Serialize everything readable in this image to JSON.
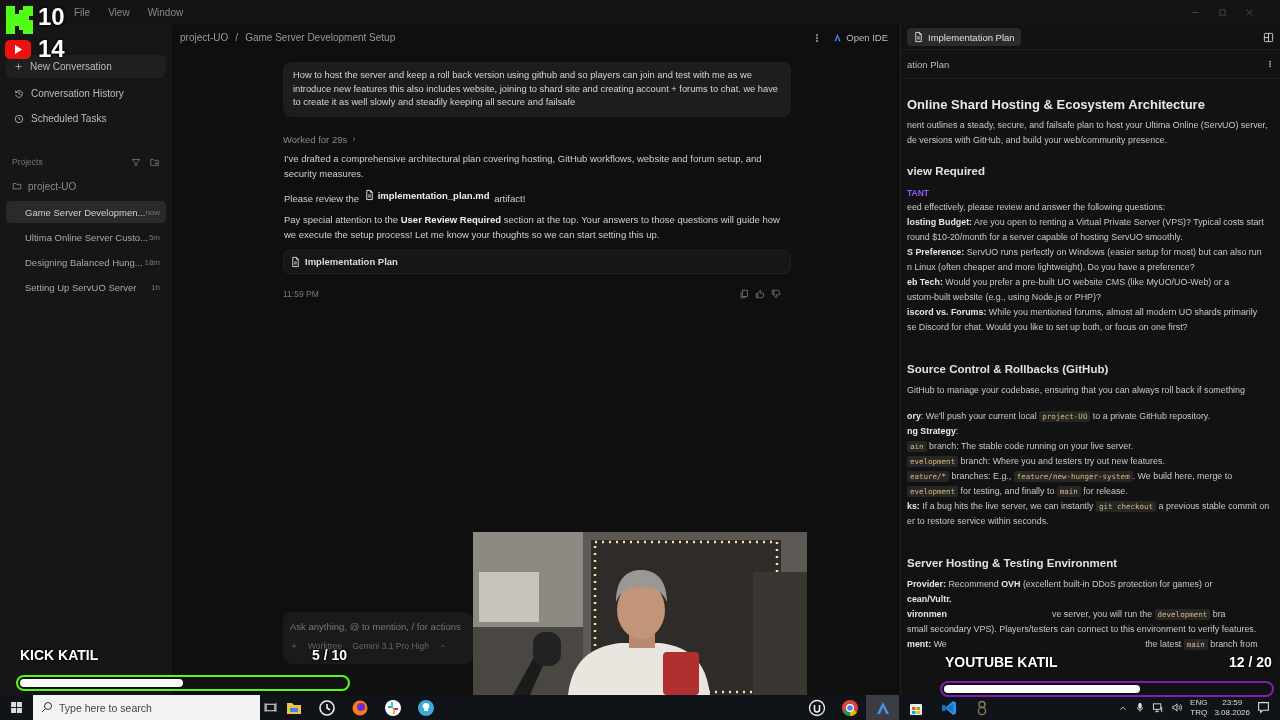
{
  "menu": [
    "File",
    "View",
    "Window"
  ],
  "sidebar": {
    "actions": [
      {
        "label": "New Conversation",
        "kind": "plus"
      },
      {
        "label": "Conversation History",
        "kind": "history"
      },
      {
        "label": "Scheduled Tasks",
        "kind": "clock"
      }
    ],
    "projects_label": "Projects",
    "project": "project-UO",
    "conversations": [
      {
        "title": "Game Server Developmen...",
        "time": "now",
        "selected": true
      },
      {
        "title": "Ultima Online Server Custo...",
        "time": "5m",
        "selected": false
      },
      {
        "title": "Designing Balanced Hung...",
        "time": "18m",
        "selected": false
      },
      {
        "title": "Setting Up ServUO Server",
        "time": "1h",
        "selected": false
      }
    ]
  },
  "breadcrumb": {
    "parent": "project-UO",
    "separator": "/",
    "title": "Game Server Development Setup"
  },
  "open_ide": "Open IDE",
  "chat": {
    "user_message": "How to host the server and keep a roll back version using github and so players can join and test with me as we introduce new features this also includes website, joining to shard site and creating account + forums to chat. we have to create it as well slowly and steadily keeping all secure and failsafe",
    "worked": "Worked for 29s",
    "summary": "I've drafted a comprehensive architectural plan covering hosting, GitHub workflows, website and forum setup, and security measures.",
    "review": {
      "before": "Please review the",
      "file": "implementation_plan.md",
      "after": "artifact!"
    },
    "attention": "Pay special attention to the **User Review Required** section at the top. Your answers to those questions will guide how we execute the setup process! Let me know your thoughts so we can start setting this up.",
    "artifact": "Implementation Plan",
    "time": "11:59 PM"
  },
  "input": {
    "placeholder": "Ask anything, @ to mention, / for actions",
    "worktree": "Worktree",
    "model": "Gemini 3.1 Pro High"
  },
  "panel": {
    "tab": {
      "label": "Implementation Plan",
      "selected": true
    },
    "title": "ation Plan",
    "lines": [
      {
        "kind": "h1",
        "segs": [
          {
            "kind": "plain",
            "text": "Online Shard Hosting & Ecosystem Architecture"
          }
        ]
      },
      {
        "kind": "p",
        "segs": [
          {
            "kind": "plain",
            "text": "nent outlines a steady, secure, and failsafe plan to host your Ultima Online (ServUO) server,"
          }
        ]
      },
      {
        "kind": "p",
        "segs": [
          {
            "kind": "plain",
            "text": "de versions with GitHub, and build your web/community presence."
          }
        ]
      },
      {
        "kind": "h2",
        "segs": [
          {
            "kind": "plain",
            "text": "view Required"
          }
        ]
      },
      {
        "kind": "alert",
        "segs": [
          {
            "kind": "plain",
            "text": "TANT"
          }
        ]
      },
      {
        "kind": "p",
        "segs": [
          {
            "kind": "plain",
            "text": "eed effectively, please review and answer the following questions:"
          }
        ]
      },
      {
        "kind": "p",
        "segs": [
          {
            "kind": "bold",
            "text": "losting Budget:"
          },
          {
            "kind": "plain",
            "text": " Are you open to renting a Virtual Private Server (VPS)? Typical costs start"
          }
        ]
      },
      {
        "kind": "p",
        "segs": [
          {
            "kind": "plain",
            "text": "round $10-20/month for a server capable of hosting ServUO smoothly."
          }
        ]
      },
      {
        "kind": "p",
        "segs": [
          {
            "kind": "bold",
            "text": "S Preference:"
          },
          {
            "kind": "plain",
            "text": " ServUO runs perfectly on Windows (easier setup for most) but can also run"
          }
        ]
      },
      {
        "kind": "p",
        "segs": [
          {
            "kind": "plain",
            "text": "n Linux (often cheaper and more lightweight). Do you have a preference?"
          }
        ]
      },
      {
        "kind": "p",
        "segs": [
          {
            "kind": "bold",
            "text": "eb Tech:"
          },
          {
            "kind": "plain",
            "text": " Would you prefer a pre-built UO website CMS (like MyUO/UO-Web) or a"
          }
        ]
      },
      {
        "kind": "p",
        "segs": [
          {
            "kind": "plain",
            "text": "ustom-built website (e.g., using Node.js or PHP)?"
          }
        ]
      },
      {
        "kind": "p",
        "segs": [
          {
            "kind": "bold",
            "text": "iscord vs. Forums:"
          },
          {
            "kind": "plain",
            "text": " While you mentioned forums, almost all modern UO shards primarily"
          }
        ]
      },
      {
        "kind": "p",
        "segs": [
          {
            "kind": "plain",
            "text": "se Discord for chat. Would you like to set up both, or focus on one first?"
          }
        ]
      },
      {
        "kind": "space"
      },
      {
        "kind": "h2",
        "segs": [
          {
            "kind": "plain",
            "text": "Source Control & Rollbacks (GitHub)"
          }
        ]
      },
      {
        "kind": "p",
        "segs": [
          {
            "kind": "plain",
            "text": "GitHub to manage your codebase, ensuring that you can always roll back if something"
          }
        ]
      },
      {
        "kind": "space"
      },
      {
        "kind": "p",
        "segs": [
          {
            "kind": "bold",
            "text": "ory"
          },
          {
            "kind": "plain",
            "text": ": We'll push your current local "
          },
          {
            "kind": "code",
            "text": "project-UO"
          },
          {
            "kind": "plain",
            "text": " to a private GitHub repository."
          }
        ]
      },
      {
        "kind": "p",
        "segs": [
          {
            "kind": "bold",
            "text": "ng Strategy"
          },
          {
            "kind": "plain",
            "text": ":"
          }
        ]
      },
      {
        "kind": "p",
        "segs": [
          {
            "kind": "code",
            "text": "ain"
          },
          {
            "kind": "plain",
            "text": " branch: The stable code running on your live server."
          }
        ]
      },
      {
        "kind": "p",
        "segs": [
          {
            "kind": "code",
            "text": "evelopment"
          },
          {
            "kind": "plain",
            "text": " branch: Where you and testers try out new features."
          }
        ]
      },
      {
        "kind": "p",
        "segs": [
          {
            "kind": "code",
            "text": "eature/*"
          },
          {
            "kind": "plain",
            "text": " branches: E.g., "
          },
          {
            "kind": "code",
            "text": "feature/new-hunger-system"
          },
          {
            "kind": "plain",
            "text": ". We build here, merge to"
          }
        ]
      },
      {
        "kind": "p",
        "segs": [
          {
            "kind": "code",
            "text": "evelopment"
          },
          {
            "kind": "plain",
            "text": " for testing, and finally to "
          },
          {
            "kind": "code",
            "text": "main"
          },
          {
            "kind": "plain",
            "text": " for release."
          }
        ]
      },
      {
        "kind": "p",
        "segs": [
          {
            "kind": "bold",
            "text": "ks:"
          },
          {
            "kind": "plain",
            "text": " If a bug hits the live server, we can instantly "
          },
          {
            "kind": "code",
            "text": "git checkout"
          },
          {
            "kind": "plain",
            "text": " a previous stable commit on"
          }
        ]
      },
      {
        "kind": "p",
        "segs": [
          {
            "kind": "plain",
            "text": "er to restore service within seconds."
          }
        ]
      },
      {
        "kind": "space"
      },
      {
        "kind": "h2",
        "segs": [
          {
            "kind": "plain",
            "text": "Server Hosting & Testing Environment"
          }
        ]
      },
      {
        "kind": "p",
        "segs": [
          {
            "kind": "bold",
            "text": "Provider:"
          },
          {
            "kind": "plain",
            "text": " Recommend "
          },
          {
            "kind": "bold",
            "text": "OVH"
          },
          {
            "kind": "plain",
            "text": " (excellent built-in DDoS protection for games) or"
          }
        ]
      },
      {
        "kind": "p",
        "segs": [
          {
            "kind": "bold",
            "text": "cean/Vultr."
          }
        ]
      },
      {
        "kind": "p",
        "segs": [
          {
            "kind": "bold",
            "text": "vironmen"
          },
          {
            "kind": "gap"
          },
          {
            "kind": "plain",
            "text": "ve server, you will run the "
          },
          {
            "kind": "code",
            "text": "development"
          },
          {
            "kind": "plain",
            "text": " bra"
          }
        ]
      },
      {
        "kind": "p",
        "segs": [
          {
            "kind": "plain",
            "text": "small secondary VPS). Players/testers can connect to this environment to verify features."
          }
        ]
      },
      {
        "kind": "p",
        "segs": [
          {
            "kind": "bold",
            "text": "ment:"
          },
          {
            "kind": "plain",
            "text": " We"
          },
          {
            "kind": "gap-wide"
          },
          {
            "kind": "plain",
            "text": " the latest "
          },
          {
            "kind": "code",
            "text": "main"
          },
          {
            "kind": "plain",
            "text": " branch from"
          }
        ]
      }
    ]
  },
  "overlays": {
    "kick_count": "10",
    "youtube_count": "14",
    "kick_goal": {
      "label": "KICK KATIL",
      "count": "5 / 10",
      "level": 0.5
    },
    "youtube_goal": {
      "label": "YOUTUBE KATIL",
      "count": "12 / 20",
      "level": 0.6
    }
  },
  "taskbar": {
    "search_placeholder": "Type here to search",
    "apps": [
      {
        "kind": "folder",
        "selected": false
      },
      {
        "kind": "clock",
        "selected": false
      },
      {
        "kind": "fox",
        "selected": false
      },
      {
        "kind": "pinwheel",
        "selected": false
      },
      {
        "kind": "bulb",
        "selected": false
      },
      {
        "kind": "split"
      },
      {
        "kind": "unreal",
        "selected": false
      },
      {
        "kind": "chrome",
        "selected": false
      },
      {
        "kind": "arrow",
        "selected": true
      },
      {
        "kind": "store",
        "selected": false
      },
      {
        "kind": "code",
        "selected": false
      },
      {
        "kind": "eight",
        "selected": false
      }
    ],
    "lang": "ENG",
    "layout": "TRQ",
    "time": "23:59",
    "date": "3.08.2026"
  }
}
